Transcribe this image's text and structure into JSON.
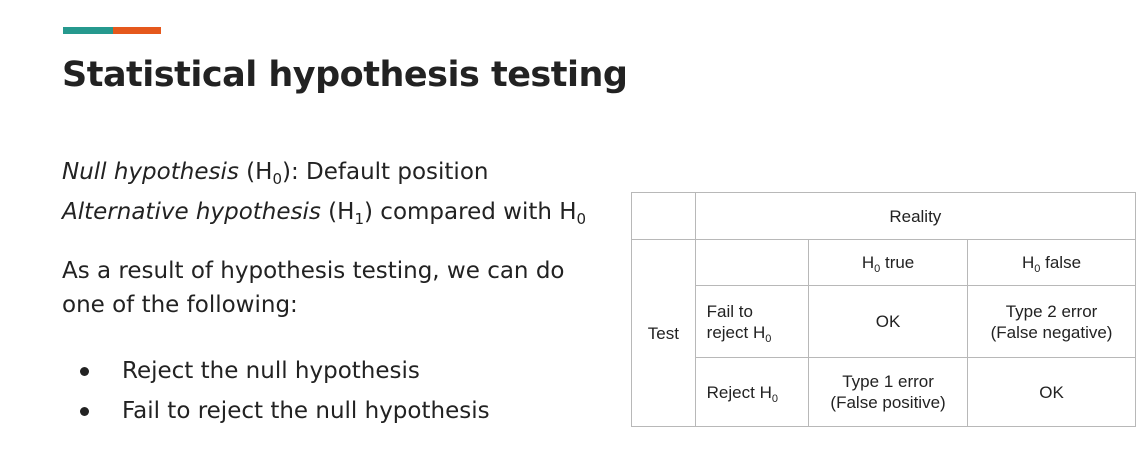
{
  "slide": {
    "title": "Statistical hypothesis testing",
    "accent_colors": [
      "#26998e",
      "#e5581c"
    ]
  },
  "definitions": {
    "null_term": "Null hypothesis",
    "null_open": " (H",
    "null_sub": "0",
    "null_rest": "): Default position",
    "alt_term": "Alternative hypothesis",
    "alt_open": " (H",
    "alt_sub": "1",
    "alt_rest": ") compared with H",
    "alt_sub2": "0"
  },
  "paragraph": {
    "line1": "As a result of hypothesis testing, we can do",
    "line2": "one of the following:"
  },
  "bullets": [
    "Reject the null hypothesis",
    "Fail to reject the null hypothesis"
  ],
  "table": {
    "reality_header": "Reality",
    "test_label": "Test",
    "h0_true_prefix": "H",
    "h0_true_sub": "0",
    "h0_true_suffix": " true",
    "h0_false_prefix": "H",
    "h0_false_sub": "0",
    "h0_false_suffix": " false",
    "fail_line1": "Fail to",
    "fail_line2_prefix": "reject H",
    "fail_line2_sub": "0",
    "reject_prefix": "Reject H",
    "reject_sub": "0",
    "fail_true_cell": "OK",
    "fail_false_line1": "Type 2 error",
    "fail_false_line2": "(False negative)",
    "reject_true_line1": "Type 1 error",
    "reject_true_line2": "(False positive)",
    "reject_false_cell": "OK"
  }
}
